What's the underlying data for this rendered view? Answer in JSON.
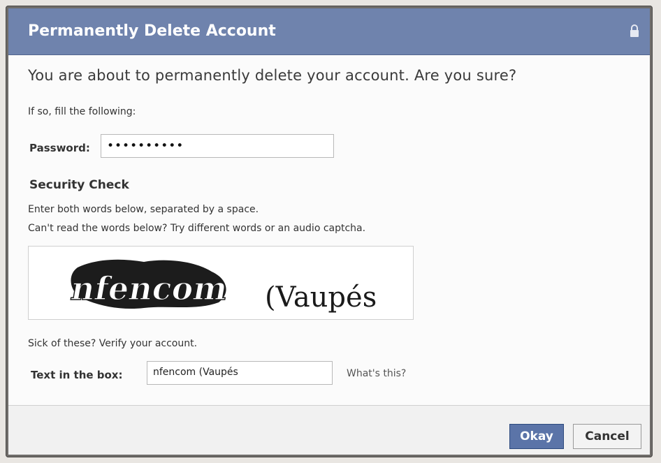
{
  "dialog": {
    "title": "Permanently Delete Account",
    "question": "You are about to permanently delete your account. Are you sure?",
    "hint": "If so, fill the following:",
    "password": {
      "label": "Password:",
      "value": "••••••••••"
    },
    "security": {
      "title": "Security Check",
      "line1": "Enter both words below, separated by a space.",
      "line2": "Can't read the words below? Try different words or an audio captcha.",
      "captcha_words": [
        "nfencom",
        "(Vaupés"
      ]
    },
    "sick_text": "Sick of these? Verify your account.",
    "text_box": {
      "label": "Text in the box:",
      "value": "nfencom (Vaupés",
      "help_link": "What's this?"
    },
    "buttons": {
      "okay": "Okay",
      "cancel": "Cancel"
    }
  },
  "colors": {
    "title_bar": "#6f83ad",
    "primary_button": "#5b74a8",
    "dialog_frame": "#6f6c69"
  },
  "icons": {
    "title_bar": "lock-icon"
  }
}
